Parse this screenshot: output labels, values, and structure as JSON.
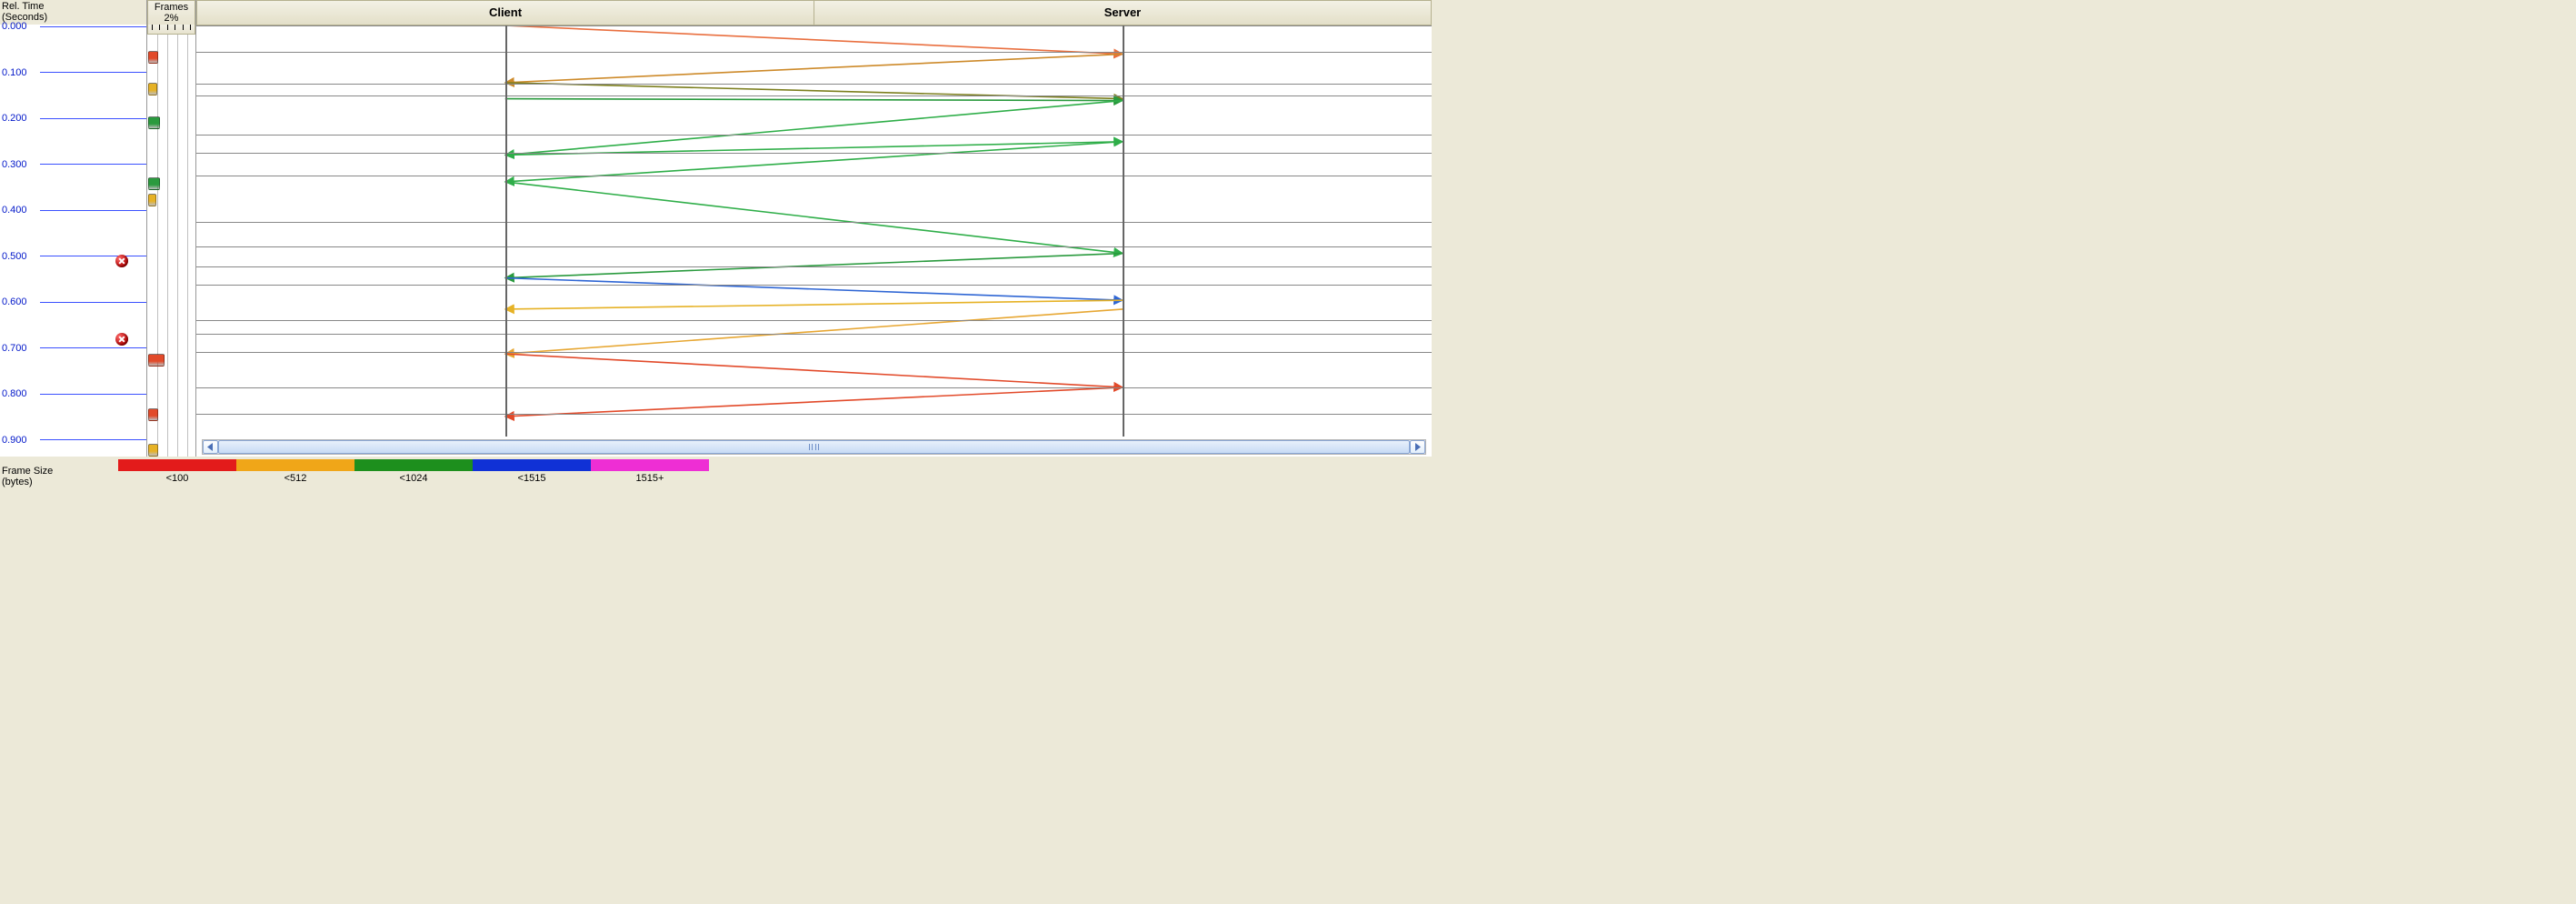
{
  "reltime": {
    "header_line1": "Rel. Time",
    "header_line2": "(Seconds)",
    "ticks": [
      "0.000",
      "0.100",
      "0.200",
      "0.300",
      "0.400",
      "0.500",
      "0.600",
      "0.700",
      "0.800",
      "0.900"
    ],
    "error_marker_times": [
      0.51,
      0.68
    ]
  },
  "frames": {
    "header_line1": "Frames",
    "header_line2": "2%",
    "bars": [
      {
        "t": 0.05,
        "width_frac": 0.22,
        "color": "#e24a2a"
      },
      {
        "t": 0.12,
        "width_frac": 0.2,
        "color": "#e6b226"
      },
      {
        "t": 0.195,
        "width_frac": 0.25,
        "color": "#2a9a3e"
      },
      {
        "t": 0.33,
        "width_frac": 0.25,
        "color": "#2a9a3e"
      },
      {
        "t": 0.365,
        "width_frac": 0.18,
        "color": "#e6b226"
      },
      {
        "t": 0.72,
        "width_frac": 0.35,
        "color": "#e24a2a"
      },
      {
        "t": 0.84,
        "width_frac": 0.22,
        "color": "#e24a2a"
      },
      {
        "t": 0.918,
        "width_frac": 0.22,
        "color": "#e6b226"
      }
    ]
  },
  "chart": {
    "endpoints": [
      "Client",
      "Server"
    ],
    "time_range": [
      0.0,
      0.92
    ],
    "hlines": [
      0.0,
      0.06,
      0.13,
      0.157,
      0.285,
      0.245,
      0.335,
      0.44,
      0.495,
      0.54,
      0.58,
      0.66,
      0.69,
      0.73,
      0.81,
      0.87
    ],
    "arrows": [
      {
        "from": "Client",
        "to": "Server",
        "t0": 0.0,
        "t1": 0.064,
        "color": "#e96f3f"
      },
      {
        "from": "Server",
        "to": "Client",
        "t0": 0.064,
        "t1": 0.128,
        "color": "#cd8a2a"
      },
      {
        "from": "Client",
        "to": "Server",
        "t0": 0.128,
        "t1": 0.164,
        "color": "#7c7f1e"
      },
      {
        "from": "Client",
        "to": "Server",
        "t0": 0.164,
        "t1": 0.168,
        "color": "#2a9a3e"
      },
      {
        "from": "Server",
        "to": "Client",
        "t0": 0.168,
        "t1": 0.29,
        "color": "#2fae49"
      },
      {
        "from": "Client",
        "to": "Server",
        "t0": 0.29,
        "t1": 0.26,
        "color": "#2fae49"
      },
      {
        "from": "Server",
        "to": "Client",
        "t0": 0.26,
        "t1": 0.35,
        "color": "#2fae49"
      },
      {
        "from": "Client",
        "to": "Server",
        "t0": 0.35,
        "t1": 0.51,
        "color": "#2fae49"
      },
      {
        "from": "Server",
        "to": "Client",
        "t0": 0.51,
        "t1": 0.565,
        "color": "#2a9a3e"
      },
      {
        "from": "Client",
        "to": "Server",
        "t0": 0.565,
        "t1": 0.615,
        "color": "#2f66d4"
      },
      {
        "from": "Server",
        "to": "Client",
        "t0": 0.615,
        "t1": 0.635,
        "color": "#e6b226"
      },
      {
        "from": "Server",
        "to": "Client",
        "t0": 0.635,
        "t1": 0.735,
        "color": "#e7a733"
      },
      {
        "from": "Client",
        "to": "Server",
        "t0": 0.735,
        "t1": 0.81,
        "color": "#e24a2a"
      },
      {
        "from": "Server",
        "to": "Client",
        "t0": 0.81,
        "t1": 0.875,
        "color": "#e24a2a"
      }
    ]
  },
  "legend": {
    "title_line1": "Frame Size",
    "title_line2": "(bytes)",
    "segments": [
      {
        "color": "#e31b1b",
        "width": 130,
        "label": "<100"
      },
      {
        "color": "#f0a618",
        "width": 130,
        "label": "<512"
      },
      {
        "color": "#1d8f1d",
        "width": 130,
        "label": "<1024"
      },
      {
        "color": "#1031d6",
        "width": 130,
        "label": "<1515"
      },
      {
        "color": "#ee2ed4",
        "width": 130,
        "label": "1515+"
      }
    ]
  },
  "chart_data": {
    "type": "sequence-bounce",
    "endpoints": [
      "Client",
      "Server"
    ],
    "y_axis": "Rel. Time (Seconds)",
    "y_range": [
      0.0,
      0.92
    ],
    "messages": [
      {
        "from": "Client",
        "to": "Server",
        "send_t": 0.0,
        "recv_t": 0.064,
        "size_bucket": "<100"
      },
      {
        "from": "Server",
        "to": "Client",
        "send_t": 0.064,
        "recv_t": 0.128,
        "size_bucket": "<512"
      },
      {
        "from": "Client",
        "to": "Server",
        "send_t": 0.128,
        "recv_t": 0.164,
        "size_bucket": "<1024"
      },
      {
        "from": "Client",
        "to": "Server",
        "send_t": 0.164,
        "recv_t": 0.168,
        "size_bucket": "<1024"
      },
      {
        "from": "Server",
        "to": "Client",
        "send_t": 0.168,
        "recv_t": 0.29,
        "size_bucket": "<1024"
      },
      {
        "from": "Client",
        "to": "Server",
        "send_t": 0.29,
        "recv_t": 0.26,
        "size_bucket": "<1024"
      },
      {
        "from": "Server",
        "to": "Client",
        "send_t": 0.26,
        "recv_t": 0.35,
        "size_bucket": "<1024"
      },
      {
        "from": "Client",
        "to": "Server",
        "send_t": 0.35,
        "recv_t": 0.51,
        "size_bucket": "<1024"
      },
      {
        "from": "Server",
        "to": "Client",
        "send_t": 0.51,
        "recv_t": 0.565,
        "size_bucket": "<1024"
      },
      {
        "from": "Client",
        "to": "Server",
        "send_t": 0.565,
        "recv_t": 0.615,
        "size_bucket": "<1515"
      },
      {
        "from": "Server",
        "to": "Client",
        "send_t": 0.615,
        "recv_t": 0.635,
        "size_bucket": "<512"
      },
      {
        "from": "Server",
        "to": "Client",
        "send_t": 0.635,
        "recv_t": 0.735,
        "size_bucket": "<512"
      },
      {
        "from": "Client",
        "to": "Server",
        "send_t": 0.735,
        "recv_t": 0.81,
        "size_bucket": "<100"
      },
      {
        "from": "Server",
        "to": "Client",
        "send_t": 0.81,
        "recv_t": 0.875,
        "size_bucket": "<100"
      }
    ],
    "errors_at": [
      0.51,
      0.68
    ]
  }
}
